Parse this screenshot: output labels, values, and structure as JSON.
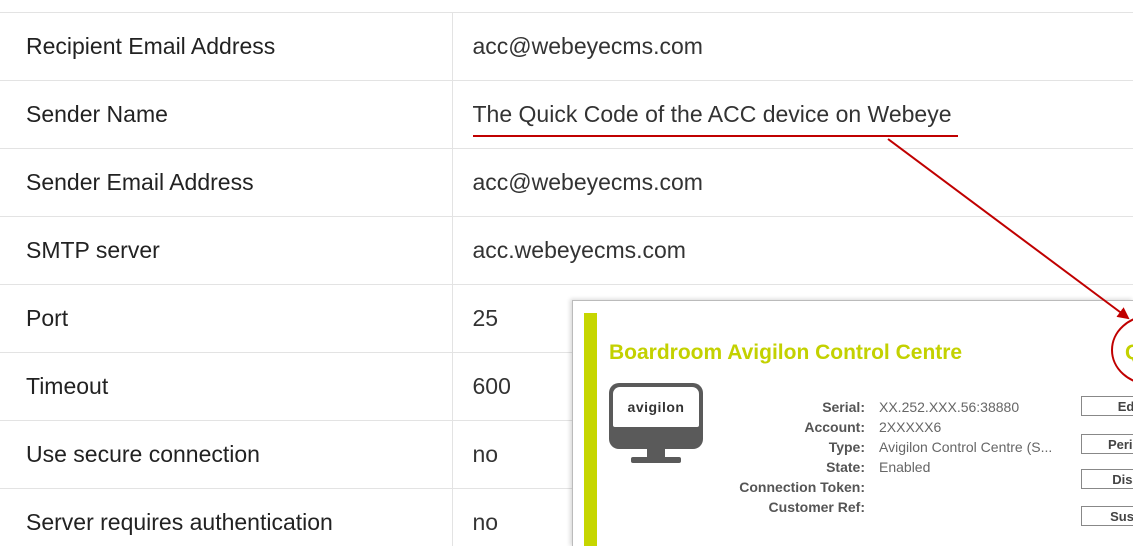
{
  "settings": [
    {
      "label": "Recipient Email Address",
      "value": "acc@webeyecms.com"
    },
    {
      "label": "Sender Name",
      "value": "The Quick Code of the ACC device on Webeye"
    },
    {
      "label": "Sender Email Address",
      "value": "acc@webeyecms.com"
    },
    {
      "label": "SMTP server",
      "value": "acc.webeyecms.com"
    },
    {
      "label": "Port",
      "value": "25"
    },
    {
      "label": "Timeout",
      "value": "600"
    },
    {
      "label": "Use secure connection",
      "value": "no"
    },
    {
      "label": "Server requires authentication",
      "value": "no"
    }
  ],
  "device_card": {
    "title": "Boardroom Avigilon Control Centre",
    "title_right": "Q",
    "logo_text": "avigilon",
    "fields": [
      {
        "label": "Serial:",
        "value": "XX.252.XXX.56:38880"
      },
      {
        "label": "Account:",
        "value": "2XXXXX6"
      },
      {
        "label": "Type:",
        "value": "Avigilon Control Centre (S..."
      },
      {
        "label": "State:",
        "value": "Enabled"
      },
      {
        "label": "Connection Token:",
        "value": ""
      },
      {
        "label": "Customer Ref:",
        "value": ""
      }
    ],
    "buttons": [
      "Ed",
      "Peripl",
      "Disa",
      "Susp"
    ]
  },
  "colors": {
    "annotation_red": "#c00000",
    "accent_lime": "#c6d600"
  }
}
